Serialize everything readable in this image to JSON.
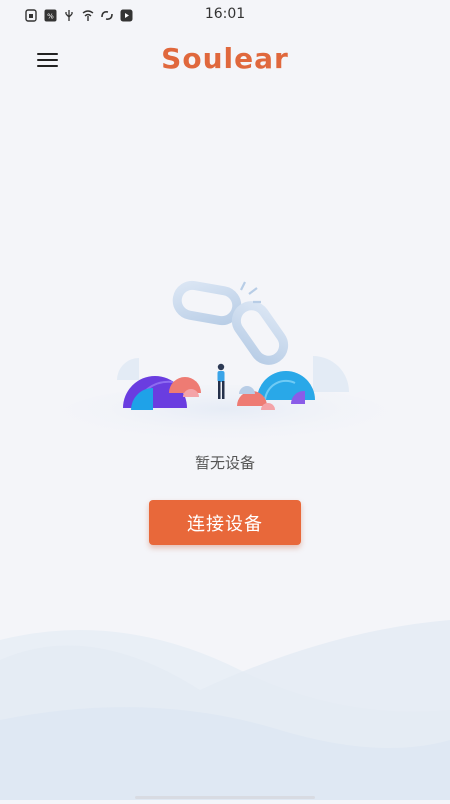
{
  "status_bar": {
    "time": "16:01",
    "icons": [
      "sim-card-icon",
      "signal-icon",
      "usb-icon",
      "network-icon",
      "sync-icon",
      "play-icon"
    ]
  },
  "header": {
    "app_title": "Soulear",
    "menu_icon": "hamburger-menu-icon",
    "brand_color": "#e0683d"
  },
  "main": {
    "illustration_icon": "broken-link-icon",
    "empty_message": "暂无设备",
    "connect_button_label": "连接设备",
    "button_color": "#e8683a"
  }
}
